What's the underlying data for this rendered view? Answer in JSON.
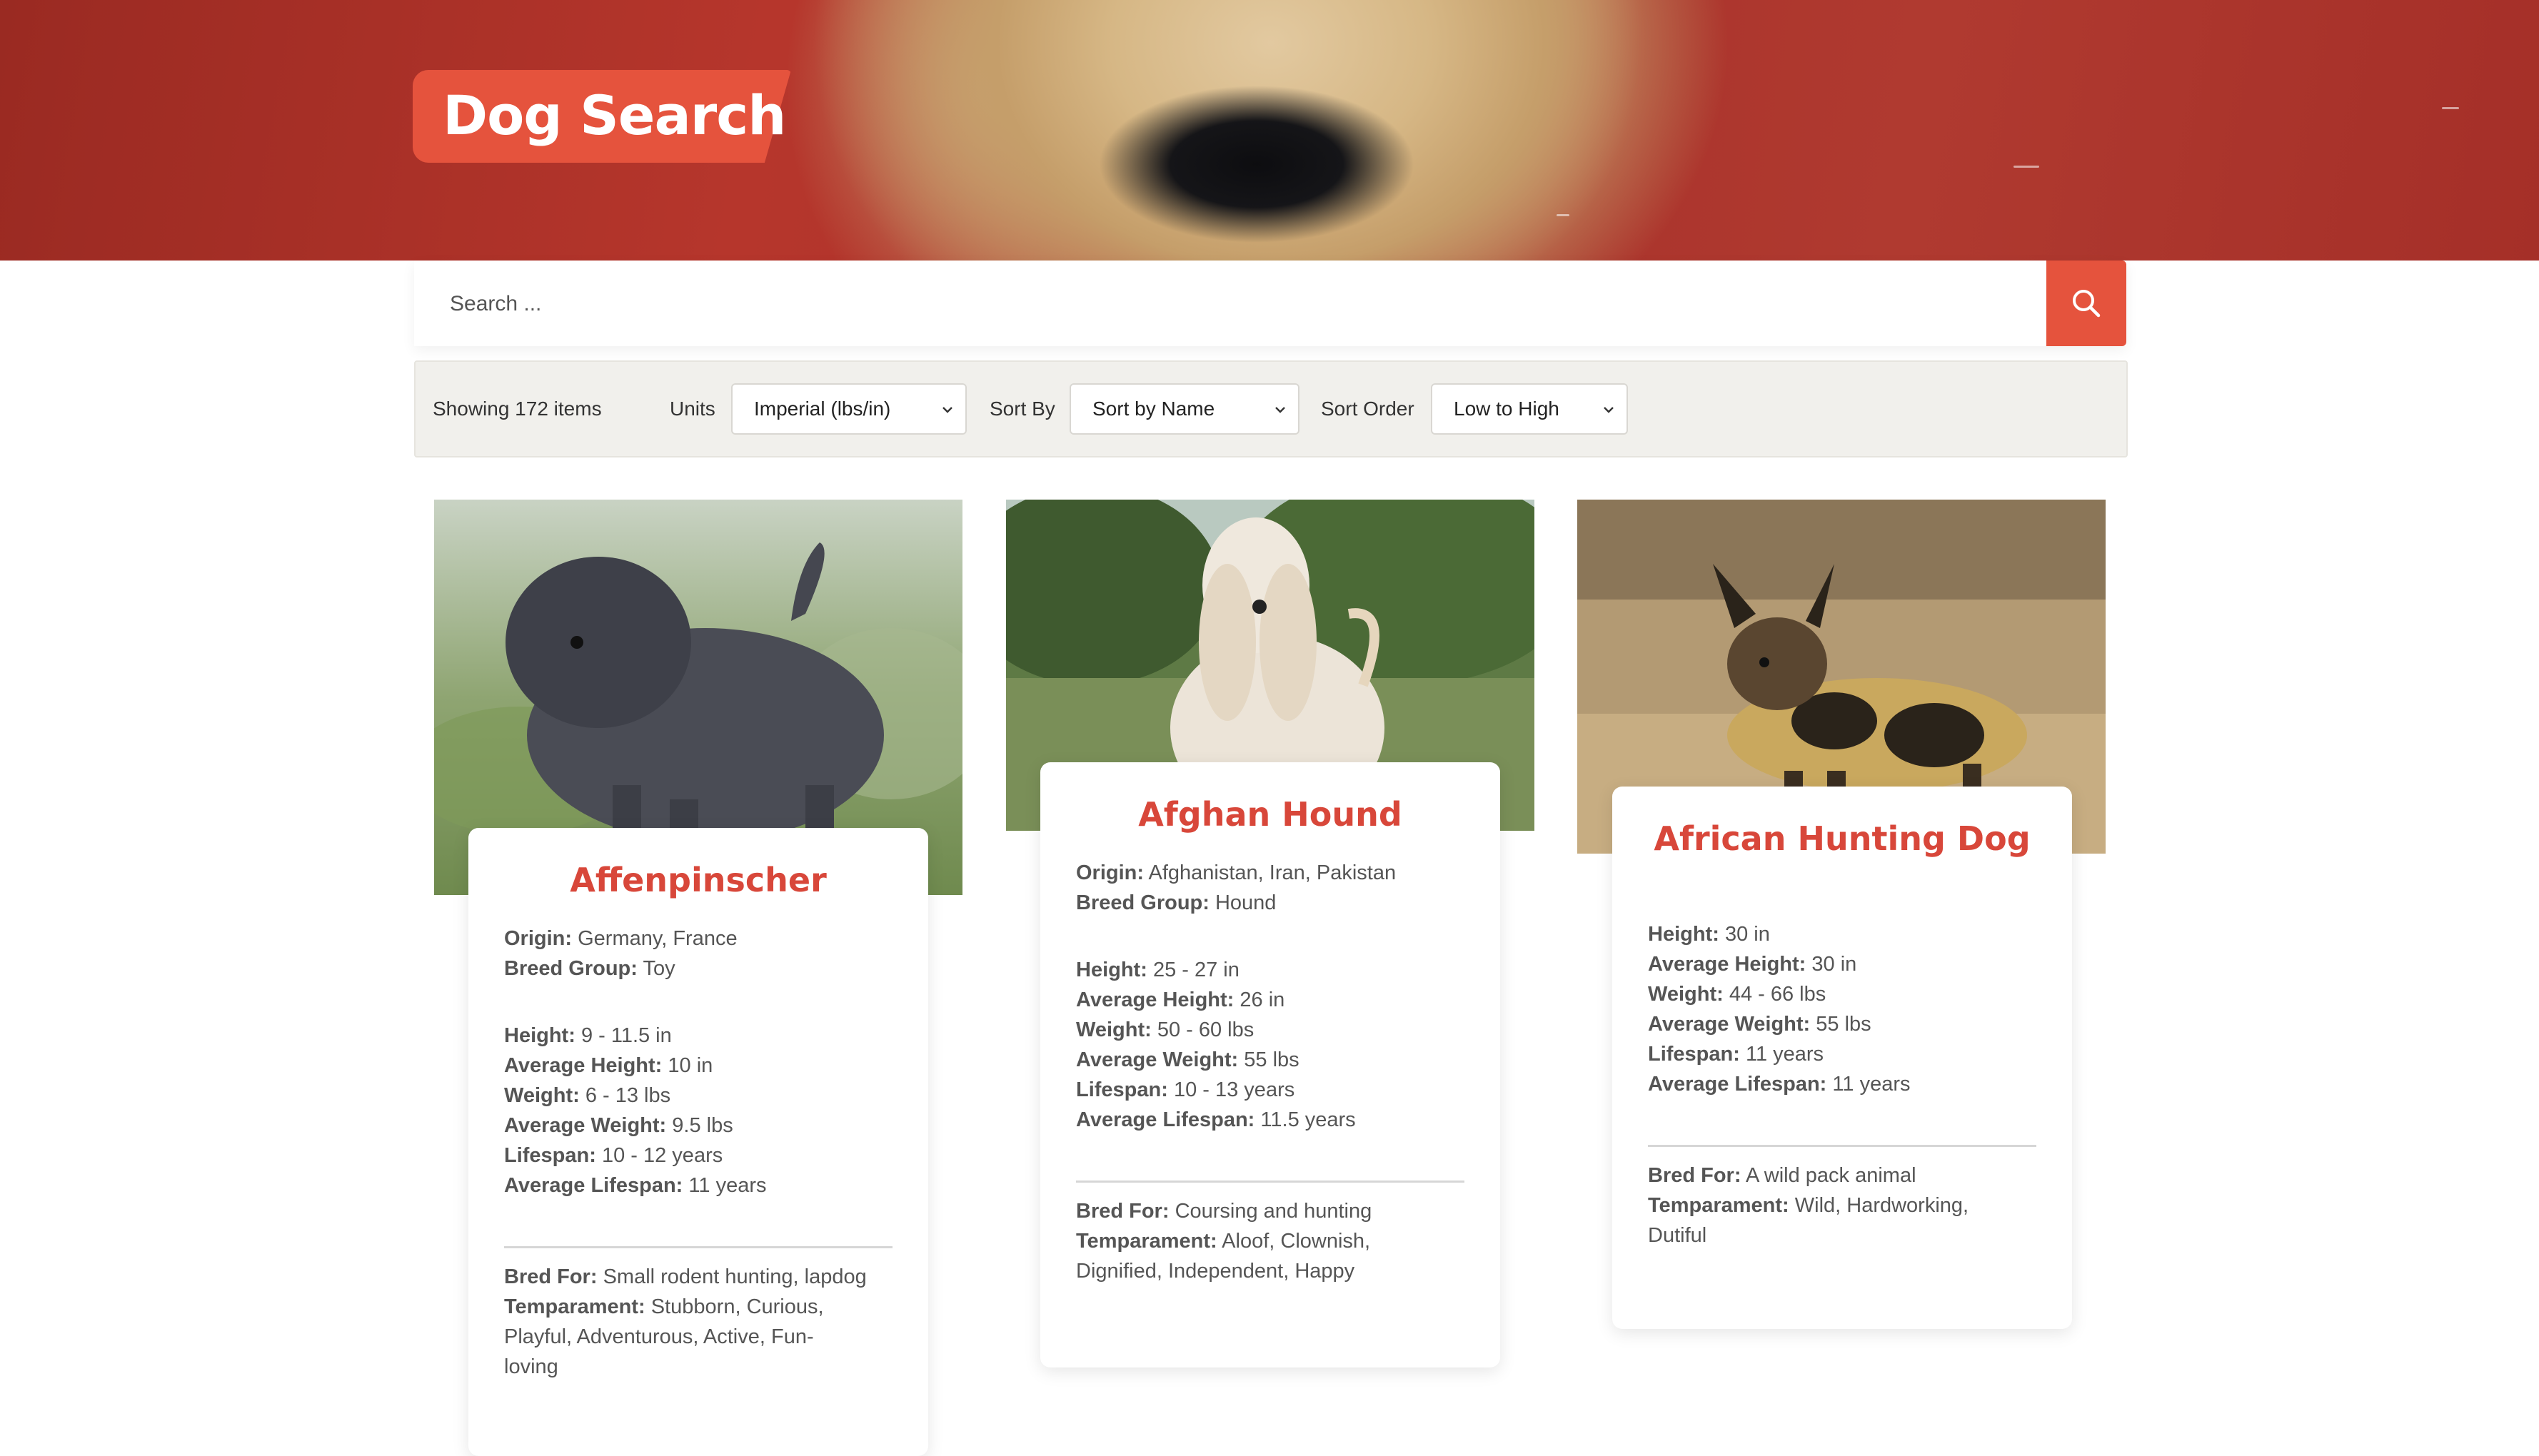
{
  "header": {
    "title": "Dog Search"
  },
  "search": {
    "placeholder": "Search ...",
    "value": ""
  },
  "filters": {
    "count_text": "Showing 172 items",
    "units_label": "Units",
    "units_value": "Imperial (lbs/in)",
    "sort_by_label": "Sort By",
    "sort_by_value": "Sort by Name",
    "sort_order_label": "Sort Order",
    "sort_order_value": "Low to High"
  },
  "labels": {
    "origin": "Origin:",
    "breed_group": "Breed Group:",
    "height": "Height:",
    "avg_height": "Average Height:",
    "weight": "Weight:",
    "avg_weight": "Average Weight:",
    "lifespan": "Lifespan:",
    "avg_lifespan": "Average Lifespan:",
    "bred_for": "Bred For:",
    "temperament": "Temparament:"
  },
  "dogs": [
    {
      "name": "Affenpinscher",
      "origin": "Germany, France",
      "breed_group": "Toy",
      "height": "9 - 11.5 in",
      "avg_height": "10 in",
      "weight": "6 - 13 lbs",
      "avg_weight": "9.5 lbs",
      "lifespan": "10 - 12 years",
      "avg_lifespan": "11 years",
      "bred_for": "Small rodent hunting, lapdog",
      "temperament_lines": [
        "Stubborn, Curious,",
        "Playful, Adventurous, Active, Fun-",
        "loving"
      ]
    },
    {
      "name": "Afghan Hound",
      "origin": "Afghanistan, Iran, Pakistan",
      "breed_group": "Hound",
      "height": "25 - 27 in",
      "avg_height": "26 in",
      "weight": "50 - 60 lbs",
      "avg_weight": "55 lbs",
      "lifespan": "10 - 13 years",
      "avg_lifespan": "11.5 years",
      "bred_for": "Coursing and hunting",
      "temperament_lines": [
        "Aloof, Clownish,",
        "Dignified, Independent, Happy"
      ]
    },
    {
      "name": "African Hunting Dog",
      "height": "30 in",
      "avg_height": "30 in",
      "weight": "44 - 66 lbs",
      "avg_weight": "55 lbs",
      "lifespan": "11 years",
      "avg_lifespan": "11 years",
      "bred_for": "A wild pack animal",
      "temperament_lines": [
        "Wild, Hardworking,",
        "Dutiful"
      ]
    }
  ],
  "colors": {
    "accent": "#e5533d",
    "title_red": "#d8473a"
  }
}
